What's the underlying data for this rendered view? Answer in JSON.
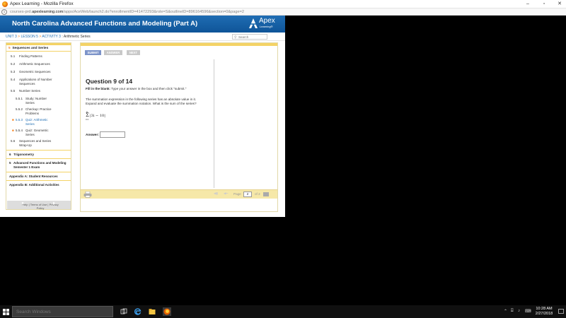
{
  "window": {
    "title": "Apex Learning - Mozilla Firefox",
    "minimize": "–",
    "maximize": "▫",
    "close": "✕"
  },
  "urlbar": {
    "info": "i",
    "url_prefix": "courses-prd.",
    "url_domain": "apexlearning.com",
    "url_path": "/apps/AceWeb/launch2.do?enrollmentID=41472293&role=S&outlineID=896164596&section=0&page=2"
  },
  "banner": {
    "course_title": "North Carolina Advanced Functions and Modeling (Part A)",
    "logo_word": "Apex",
    "logo_sub": "Learning®"
  },
  "breadcrumb": {
    "unit": "UNIT 3",
    "lesson": "LESSON 5",
    "activity": "ACTIVITY 3",
    "current": "Arithmetic Series",
    "sep": ">",
    "colon": ":"
  },
  "search": {
    "placeholder": "Search"
  },
  "sidebar": {
    "unit_num": "5",
    "unit_title": "Sequences and Series",
    "items": [
      {
        "num": "5.1",
        "label": "Finding Patterns"
      },
      {
        "num": "5.2",
        "label": "Arithmetic Sequences"
      },
      {
        "num": "5.3",
        "label": "Geometric Sequences"
      },
      {
        "num": "5.4",
        "label_1": "Applications of Number",
        "label_2": "Sequences"
      },
      {
        "num": "5.5",
        "label": "Number Series"
      },
      {
        "num": "5.5.1",
        "label_1": "Study: Number",
        "label_2": "Series"
      },
      {
        "num": "5.5.2",
        "label_1": "Checkup: Practice",
        "label_2": "Problems"
      },
      {
        "num": "5.5.3",
        "label_1": "Quiz: Arithmetic",
        "label_2": "Series"
      },
      {
        "num": "5.5.4",
        "label_1": "Quiz: Geometric",
        "label_2": "Series"
      },
      {
        "num": "5.6",
        "label_1": "Sequences and Series",
        "label_2": "Wrap-Up"
      }
    ],
    "heads": [
      {
        "num": "6",
        "label": "Trigonometry"
      },
      {
        "num": "5",
        "label_1": "Advanced Functions and Modeling",
        "label_2": "Semester 1 Exam"
      },
      {
        "label": "Appendix A: Student Resources"
      },
      {
        "label": "Appendix B: Additional Activities"
      }
    ],
    "star": "■"
  },
  "footer": {
    "help": "Help",
    "terms": "Terms of Use",
    "privacy": "Privacy",
    "policy": "Policy",
    "sep": "|"
  },
  "toolbar": {
    "submit": "SUBMIT",
    "answer": "ANSWER",
    "next": "NEXT"
  },
  "question": {
    "title": "Question 9 of 14",
    "instr_bold": "Fill in the blank:",
    "instr_rest": " Type your answer in the box and then click \"submit.\"",
    "prompt_1": "The summation expression in the following series has an absolute value in it.",
    "prompt_2": "Expand and evaluate the summation notation. What is the sum of the series?",
    "sigma_upper": "6",
    "sigma_lower": "i=1",
    "expression": "|3i − 10|",
    "answer_label": "Answer:",
    "answer_value": ""
  },
  "pager": {
    "page_label": "Page",
    "page_value": "2",
    "of_label": "of 2"
  },
  "taskbar": {
    "search_placeholder": "Search Windows",
    "time": "10:28 AM",
    "date": "2/27/2018"
  },
  "colors": {
    "banner": "#1466ab",
    "accent_orange": "#f58220",
    "stripe_yellow": "#f4d366",
    "button_blue": "#7d94c9",
    "button_grey": "#c9c9c9"
  }
}
